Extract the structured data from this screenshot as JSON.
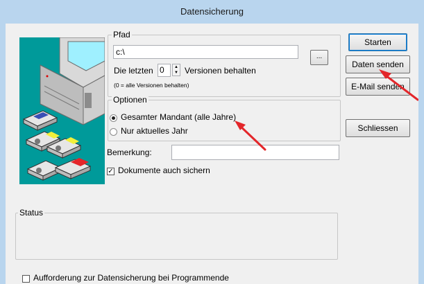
{
  "window": {
    "title": "Datensicherung"
  },
  "pfad_group": {
    "legend": "Pfad",
    "path_value": "c:\\",
    "browse_label": "...",
    "versions_prefix": "Die letzten",
    "versions_value": "0",
    "versions_suffix": "Versionen behalten",
    "versions_hint": "(0 = alle Versionen behalten)"
  },
  "optionen_group": {
    "legend": "Optionen",
    "options": [
      {
        "label": "Gesamter Mandant (alle Jahre)",
        "selected": true
      },
      {
        "label": "Nur aktuelles Jahr",
        "selected": false
      }
    ]
  },
  "bemerkung": {
    "label": "Bemerkung:",
    "value": ""
  },
  "dokumente": {
    "label": "Dokumente auch sichern",
    "checked": true
  },
  "buttons": {
    "starten": "Starten",
    "daten_senden": "Daten senden",
    "email_senden": "E-Mail senden",
    "schliessen": "Schliessen"
  },
  "status_group": {
    "legend": "Status"
  },
  "footer": {
    "aufforderung_label": "Aufforderung zur Datensicherung bei Programmende",
    "checked": false
  },
  "colors": {
    "titlebar": "#b9d5ee",
    "client": "#f0f0f0",
    "annotation_arrow": "#e3262a",
    "illustration_bg": "#009a9a"
  },
  "icons": [
    "computer-floppy-illustration",
    "red-arrow-annotation"
  ]
}
